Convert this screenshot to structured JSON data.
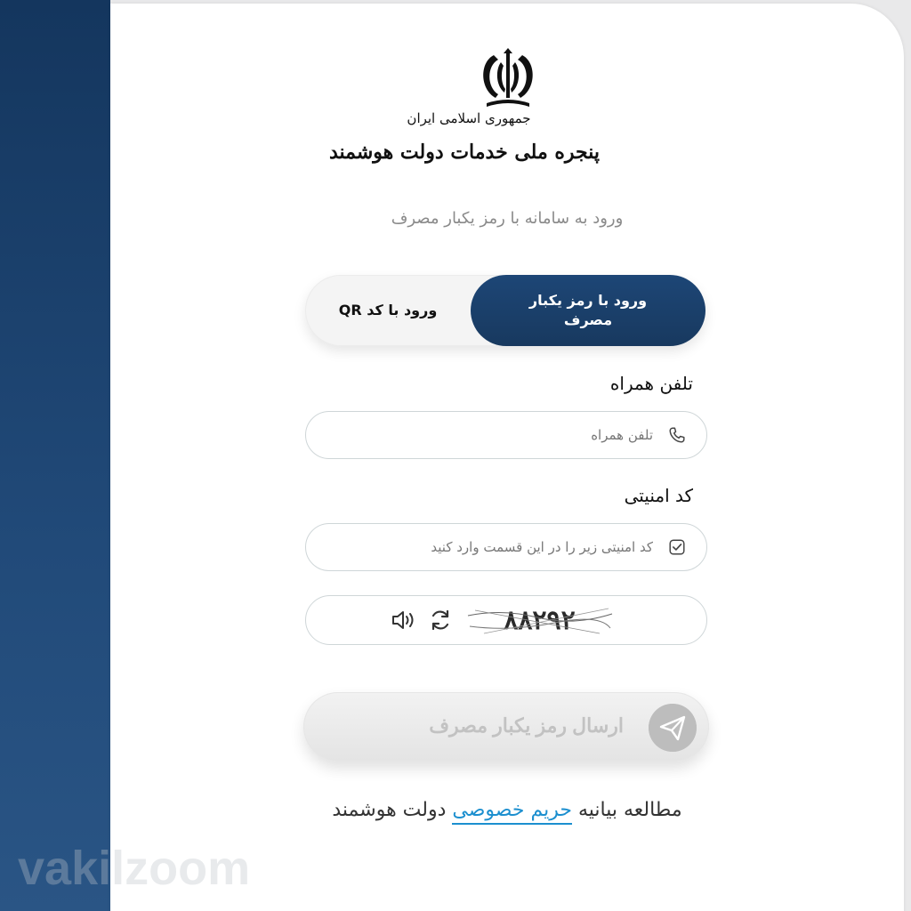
{
  "logo": {
    "line1": "جمهوری اسلامی ایران",
    "line2": "پنجره ملی خدمات دولت هوشمند"
  },
  "subtitle": "ورود به سامانه با رمز یکبار مصرف",
  "login_tabs": [
    {
      "label": "ورود با رمز یکبار مصرف",
      "active": true
    },
    {
      "label": "ورود با کد QR",
      "active": false
    }
  ],
  "phone": {
    "label": "تلفن همراه",
    "placeholder": "تلفن همراه",
    "icon": "phone-icon"
  },
  "security": {
    "label": "کد امنیتی",
    "placeholder": "کد امنیتی زیر را در این قسمت وارد کنید",
    "icon": "checkbox-icon"
  },
  "captcha": {
    "code": "۸۸۲۹۲",
    "refresh_icon": "refresh-icon",
    "audio_icon": "speaker-icon"
  },
  "submit": {
    "label": "ارسال رمز یکبار مصرف",
    "icon": "send-icon",
    "disabled": true
  },
  "privacy": {
    "prefix": "مطالعه بیانیه",
    "link": "حریم خصوصی",
    "suffix": "دولت هوشمند"
  },
  "watermark": "vakilzoom",
  "colors": {
    "primary": "#1d4676",
    "link": "#1c8fcf",
    "disabled": "#c2c2c2"
  }
}
